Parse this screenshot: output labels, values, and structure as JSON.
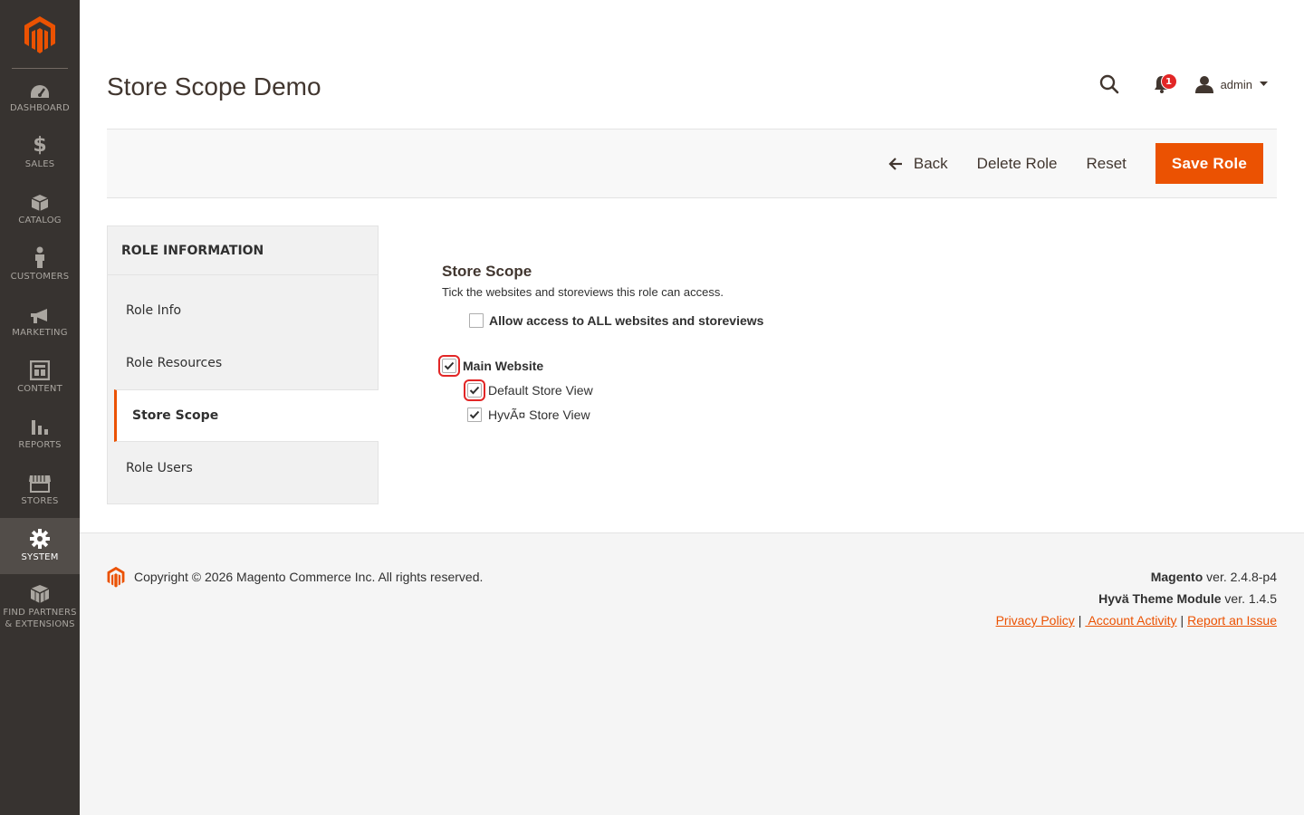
{
  "sidebar": {
    "items": [
      {
        "label": "DASHBOARD",
        "icon": "dashboard-icon"
      },
      {
        "label": "SALES",
        "icon": "dollar-icon"
      },
      {
        "label": "CATALOG",
        "icon": "box-icon"
      },
      {
        "label": "CUSTOMERS",
        "icon": "person-icon"
      },
      {
        "label": "MARKETING",
        "icon": "megaphone-icon"
      },
      {
        "label": "CONTENT",
        "icon": "layout-icon"
      },
      {
        "label": "REPORTS",
        "icon": "bar-chart-icon"
      },
      {
        "label": "STORES",
        "icon": "storefront-icon"
      },
      {
        "label": "SYSTEM",
        "icon": "gear-icon"
      },
      {
        "label_line1": "FIND PARTNERS",
        "label_line2": "& EXTENSIONS",
        "icon": "cubes-icon"
      }
    ]
  },
  "header": {
    "title": "Store Scope Demo",
    "notification_count": "1",
    "user_name": "admin"
  },
  "actions": {
    "back": "Back",
    "delete": "Delete Role",
    "reset": "Reset",
    "save": "Save Role"
  },
  "tabs": {
    "title": "ROLE INFORMATION",
    "items": [
      "Role Info",
      "Role Resources",
      "Store Scope",
      "Role Users"
    ],
    "active": "Store Scope"
  },
  "scope": {
    "title": "Store Scope",
    "description": "Tick the websites and storeviews this role can access.",
    "all_label": "Allow access to ALL websites and storeviews",
    "all_checked": false,
    "website_label": "Main Website",
    "website_checked": true,
    "store_views": [
      {
        "label": "Default Store View",
        "checked": true
      },
      {
        "label": "HyvÃ¤ Store View",
        "checked": true
      }
    ]
  },
  "footer": {
    "copyright": "Copyright © 2026 Magento Commerce Inc. All rights reserved.",
    "magento_name": "Magento",
    "magento_version": " ver. 2.4.8-p4",
    "hyva_name": "Hyvä Theme Module",
    "hyva_version": " ver. 1.4.5",
    "links": [
      "Privacy Policy",
      " Account Activity",
      "Report an Issue"
    ]
  },
  "colors": {
    "accent": "#eb5202",
    "sidebar_bg": "#373330",
    "highlight": "#e22626"
  }
}
